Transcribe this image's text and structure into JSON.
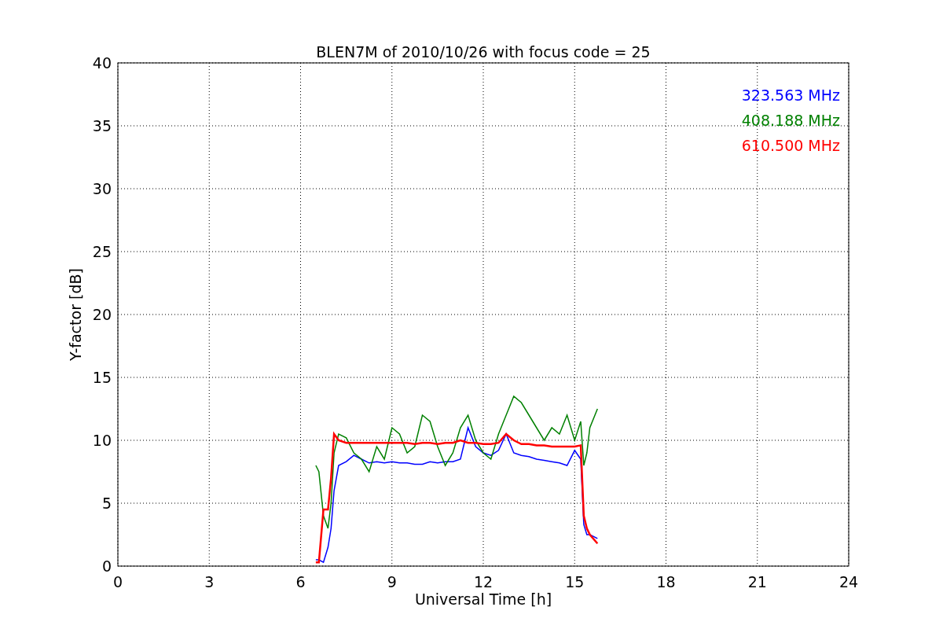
{
  "chart_data": {
    "type": "line",
    "title": "BLEN7M of 2010/10/26 with focus code = 25",
    "xlabel": "Universal Time [h]",
    "ylabel": "Y-factor [dB]",
    "x": [
      6.5,
      6.6,
      6.75,
      6.9,
      7.0,
      7.1,
      7.25,
      7.5,
      7.75,
      8,
      8.25,
      8.5,
      8.75,
      9,
      9.25,
      9.5,
      9.75,
      10,
      10.25,
      10.5,
      10.75,
      11,
      11.25,
      11.5,
      11.75,
      12,
      12.25,
      12.5,
      12.75,
      13,
      13.25,
      13.5,
      13.75,
      14,
      14.25,
      14.5,
      14.75,
      15,
      15.2,
      15.3,
      15.4,
      15.5,
      15.75
    ],
    "series": [
      {
        "name": "323.563 MHz",
        "color": "#0000ff",
        "values": [
          0.5,
          0.5,
          0.3,
          1.5,
          3,
          6,
          8,
          8.3,
          8.8,
          8.5,
          8.2,
          8.3,
          8.2,
          8.3,
          8.2,
          8.2,
          8.1,
          8.1,
          8.3,
          8.2,
          8.3,
          8.3,
          8.5,
          11,
          9.5,
          9,
          8.8,
          9.2,
          10.5,
          9,
          8.8,
          8.7,
          8.5,
          8.4,
          8.3,
          8.2,
          8,
          9.2,
          8.5,
          3.3,
          2.5,
          2.5,
          2.2
        ]
      },
      {
        "name": "408.188 MHz",
        "color": "#008000",
        "values": [
          8,
          7.5,
          4,
          3,
          5,
          9,
          10.5,
          10.2,
          9,
          8.5,
          7.5,
          9.5,
          8.5,
          11,
          10.5,
          9,
          9.5,
          12,
          11.5,
          9.5,
          8,
          9,
          11,
          12,
          10,
          9,
          8.5,
          10.5,
          12,
          13.5,
          13,
          12,
          11,
          10,
          11,
          10.5,
          12,
          10,
          11.5,
          8,
          9,
          11,
          12.5
        ]
      },
      {
        "name": "610.500 MHz",
        "color": "#ff0000",
        "values": [
          0.3,
          0.3,
          4.5,
          4.5,
          7,
          10.5,
          10,
          9.8,
          9.8,
          9.8,
          9.8,
          9.8,
          9.8,
          9.8,
          9.8,
          9.8,
          9.7,
          9.8,
          9.8,
          9.7,
          9.8,
          9.8,
          10,
          9.8,
          9.8,
          9.7,
          9.7,
          9.8,
          10.5,
          10,
          9.7,
          9.7,
          9.6,
          9.6,
          9.5,
          9.5,
          9.5,
          9.5,
          9.6,
          4,
          3,
          2.5,
          1.8
        ]
      }
    ],
    "xlim": [
      0,
      24
    ],
    "ylim": [
      0,
      40
    ],
    "xticks": [
      0,
      3,
      6,
      9,
      12,
      15,
      18,
      21,
      24
    ],
    "yticks": [
      0,
      5,
      10,
      15,
      20,
      25,
      30,
      35,
      40
    ],
    "grid": true
  }
}
